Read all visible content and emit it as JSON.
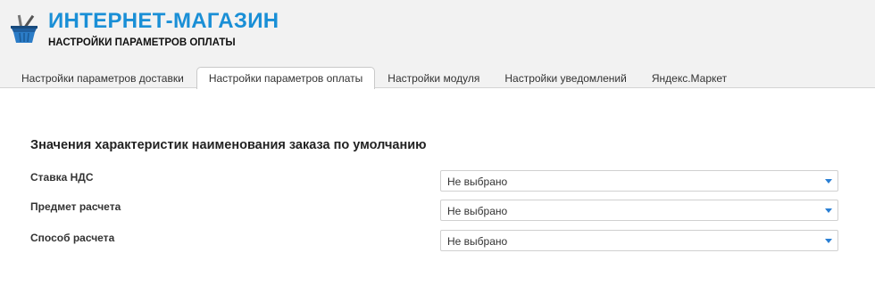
{
  "header": {
    "title": "ИНТЕРНЕТ-МАГАЗИН",
    "subtitle": "НАСТРОЙКИ ПАРАМЕТРОВ ОПЛАТЫ",
    "logo_icon": "shopping-basket-icon"
  },
  "tabs": [
    {
      "label": "Настройки параметров доставки",
      "active": false
    },
    {
      "label": "Настройки параметров оплаты",
      "active": true
    },
    {
      "label": "Настройки модуля",
      "active": false
    },
    {
      "label": "Настройки уведомлений",
      "active": false
    },
    {
      "label": "Яндекс.Маркет",
      "active": false
    }
  ],
  "section": {
    "title": "Значения характеристик наименования заказа по умолчанию"
  },
  "fields": [
    {
      "label": "Ставка НДС",
      "value": "Не выбрано"
    },
    {
      "label": "Предмет расчета",
      "value": "Не выбрано"
    },
    {
      "label": "Способ расчета",
      "value": "Не выбрано"
    }
  ],
  "colors": {
    "accent": "#1a8fd6",
    "caret": "#2a7fd4",
    "header_bg": "#f2f2f2"
  }
}
